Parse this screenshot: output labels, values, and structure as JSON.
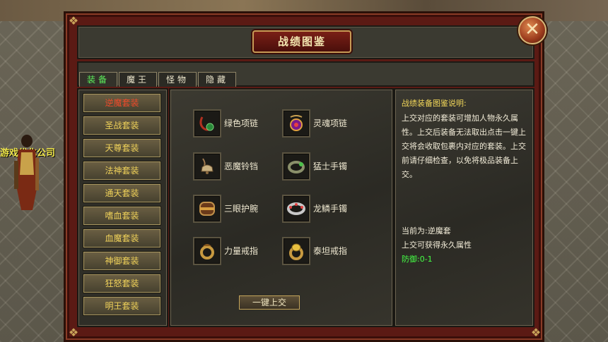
{
  "background": {
    "side_text": "游戏优化公司"
  },
  "window": {
    "title": "战绩图鉴",
    "close_icon": "close-x-icon"
  },
  "tabs": [
    {
      "label": "装备",
      "active": true
    },
    {
      "label": "魔王",
      "active": false
    },
    {
      "label": "怪物",
      "active": false
    },
    {
      "label": "隐藏",
      "active": false
    }
  ],
  "sets": [
    {
      "label": "逆魔套装",
      "active": true
    },
    {
      "label": "圣战套装",
      "active": false
    },
    {
      "label": "天尊套装",
      "active": false
    },
    {
      "label": "法神套装",
      "active": false
    },
    {
      "label": "通天套装",
      "active": false
    },
    {
      "label": "嗜血套装",
      "active": false
    },
    {
      "label": "血魔套装",
      "active": false
    },
    {
      "label": "神御套装",
      "active": false
    },
    {
      "label": "狂怒套装",
      "active": false
    },
    {
      "label": "明王套装",
      "active": false
    }
  ],
  "items": [
    {
      "label": "绿色项链",
      "icon": "green-necklace-icon"
    },
    {
      "label": "灵魂项链",
      "icon": "soul-necklace-icon"
    },
    {
      "label": "恶魔铃铛",
      "icon": "demon-bell-icon"
    },
    {
      "label": "猛士手镯",
      "icon": "warrior-bracelet-icon"
    },
    {
      "label": "三眼护腕",
      "icon": "three-eye-bracer-icon"
    },
    {
      "label": "龙鳞手镯",
      "icon": "dragon-scale-bracelet-icon"
    },
    {
      "label": "力量戒指",
      "icon": "power-ring-icon"
    },
    {
      "label": "泰坦戒指",
      "icon": "titan-ring-icon"
    }
  ],
  "submit_label": "一键上交",
  "description": {
    "title": "战绩装备图鉴说明:",
    "body": "上交对应的套装可增加人物永久属性。上交后装备无法取出点击一键上交将会收取包裹内对应的套装。上交前请仔细检查，以免将极品装备上交。",
    "current": "当前为:逆魔套",
    "attribute_note": "上交可获得永久属性",
    "stat": "防御:0-1"
  }
}
